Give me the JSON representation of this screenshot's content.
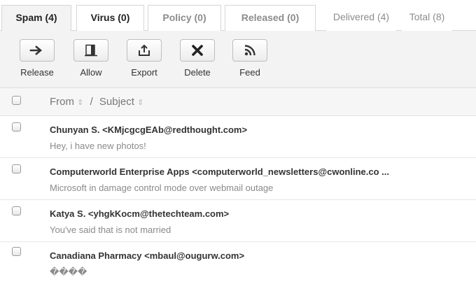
{
  "tabs": [
    {
      "label": "Spam (4)"
    },
    {
      "label": "Virus (0)"
    },
    {
      "label": "Policy (0)"
    },
    {
      "label": "Released (0)"
    }
  ],
  "counts": {
    "delivered": "Delivered (4)",
    "total": "Total (8)"
  },
  "toolbar": {
    "release": "Release",
    "allow": "Allow",
    "export": "Export",
    "delete": "Delete",
    "feed": "Feed"
  },
  "columns": {
    "from": "From",
    "separator": "/",
    "subject": "Subject"
  },
  "messages": [
    {
      "from": "Chunyan S. <KMjcgcgEAb@redthought.com>",
      "subject": "Hey, i have new photos!"
    },
    {
      "from": "Computerworld Enterprise Apps <computerworld_newsletters@cwonline.co ...",
      "subject": "Microsoft in damage control mode over webmail outage"
    },
    {
      "from": "Katya S. <yhgkKocm@thetechteam.com>",
      "subject": "You've said that is not married"
    },
    {
      "from": "Canadiana Pharmacy <mbaul@ougurw.com>",
      "subject": "����"
    }
  ]
}
